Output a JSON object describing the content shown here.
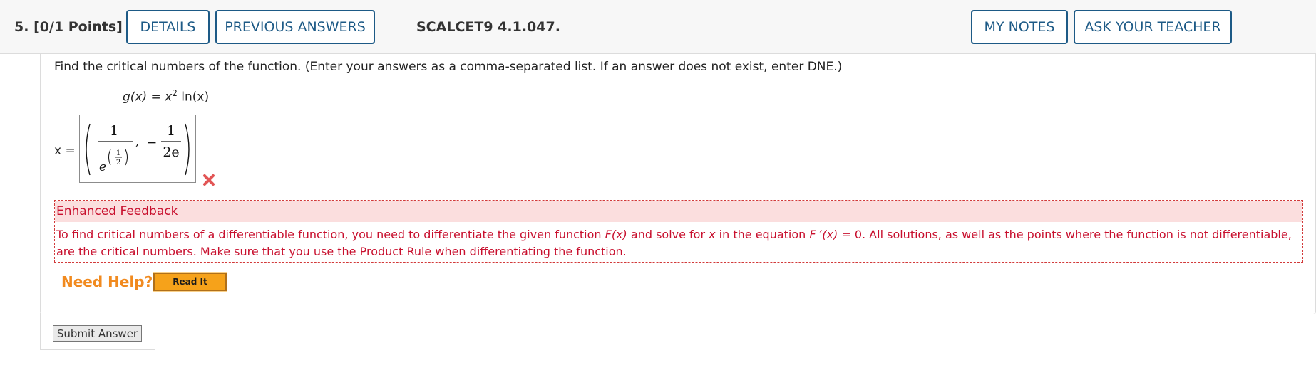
{
  "header": {
    "question_number": "5.",
    "points": "[0/1 Points]",
    "details_label": "DETAILS",
    "previous_answers_label": "PREVIOUS ANSWERS",
    "question_code": "SCALCET9 4.1.047.",
    "my_notes_label": "MY NOTES",
    "ask_teacher_label": "ASK YOUR TEACHER"
  },
  "question": {
    "instructions": "Find the critical numbers of the function. (Enter your answers as a comma-separated list. If an answer does not exist, enter DNE.)",
    "function_lhs": "g(x)",
    "function_equals": " = ",
    "function_base": "x",
    "function_exponent": "2",
    "function_rest": " ln(x)"
  },
  "answer": {
    "variable_label": "x =",
    "entry": {
      "first_term": {
        "numerator": "1",
        "base": "e",
        "exponent_numerator": "1",
        "exponent_denominator": "2"
      },
      "separator": ",",
      "sign": "−",
      "second_term": {
        "numerator": "1",
        "denominator": "2e"
      }
    },
    "status": "incorrect"
  },
  "feedback": {
    "title": "Enhanced Feedback",
    "text_1": "To find critical numbers of a differentiable function, you need to differentiate the given function ",
    "F_x": "F(x)",
    "text_2": " and solve for ",
    "x": "x",
    "text_3": " in the equation ",
    "F_prime_x": "F ′(x)",
    "text_4": " = 0. All solutions, as well as the points where the function is not differentiable, are the critical numbers. Make sure that you use the Product Rule when differentiating the function."
  },
  "help": {
    "need_help_label": "Need Help?",
    "read_it_label": "Read It"
  },
  "submit_label": "Submit Answer",
  "colors": {
    "header_button": "#1d5a86",
    "feedback_text": "#c8102e",
    "feedback_bg": "#fbdede",
    "need_help": "#f18a1f",
    "read_it_bg": "#f6a21a",
    "wrong_mark": "#e25555"
  },
  "icons": [
    "wrong-answer-x-icon"
  ]
}
